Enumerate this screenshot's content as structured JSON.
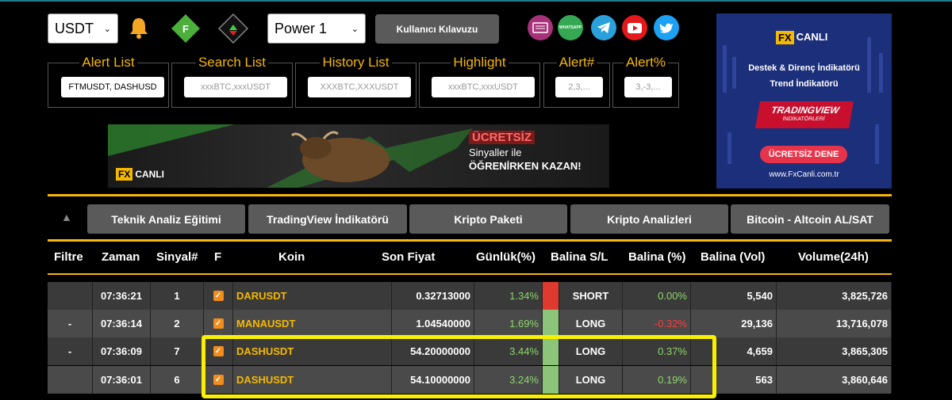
{
  "top": {
    "currency": "USDT",
    "power": "Power 1",
    "guide_label": "Kullanıcı Kılavuzu",
    "icons": [
      "bell-icon",
      "green-diamond-f-icon",
      "red-green-arrow-diamond-icon",
      "book-icon",
      "whatsapp-icon",
      "telegram-icon",
      "youtube-icon",
      "twitter-icon"
    ],
    "badge_letter": "F",
    "whatsapp_text": "WHATSAPP"
  },
  "filters": [
    {
      "label": "Alert List",
      "value": "FTMUSDT, DASHUSD",
      "placeholder": ""
    },
    {
      "label": "Search List",
      "value": "",
      "placeholder": "xxxBTC,xxxUSDT"
    },
    {
      "label": "History List",
      "value": "",
      "placeholder": "XXXBTC,XXXUSDT"
    },
    {
      "label": "Highlight",
      "value": "",
      "placeholder": "xxxBTC,xxxUSDT"
    },
    {
      "label": "Alert#",
      "value": "",
      "placeholder": "2,3,..."
    },
    {
      "label": "Alert%",
      "value": "",
      "placeholder": "3,-3,..."
    }
  ],
  "banner": {
    "logo_fx": "FX",
    "logo_text": "CANLI",
    "line1": "ÜCRETSİZ",
    "line2": "Sinyaller ile",
    "line3": "ÖĞRENİRKEN KAZAN!"
  },
  "ad": {
    "logo_fx": "FX",
    "logo_text": "CANLI",
    "line1": "Destek & Direnç İndikatörü",
    "line2": "Trend İndikatörü",
    "tv1": "TRADINGVIEW",
    "tv2": "İNDİKATÖRLERİ",
    "cta": "ÜCRETSİZ DENE",
    "url": "www.FxCanli.com.tr"
  },
  "nav": {
    "collapse_icon": "▲",
    "buttons": [
      "Teknik Analiz Eğitimi",
      "TradingView İndikatörü",
      "Kripto Paketi",
      "Kripto Analizleri",
      "Bitcoin - Altcoin AL/SAT"
    ]
  },
  "table": {
    "headers": [
      "Filtre",
      "Zaman",
      "Sinyal#",
      "F",
      "Koin",
      "Son Fiyat",
      "Günlük(%)",
      "Balina S/L",
      "Balina (%)",
      "Balina (Vol)",
      "Volume(24h)"
    ],
    "rows": [
      {
        "filtre": "",
        "zaman": "07:36:21",
        "sinyal": "1",
        "koin": "DARUSDT",
        "fiyat": "0.32713000",
        "gunluk": "1.34%",
        "side_color": "#e03a2e",
        "sl": "SHORT",
        "balina_pct": "0.00%",
        "pct_color": "green",
        "vol": "5,540",
        "volume": "3,825,726"
      },
      {
        "filtre": "-",
        "zaman": "07:36:14",
        "sinyal": "2",
        "koin": "MANAUSDT",
        "fiyat": "1.04540000",
        "gunluk": "1.69%",
        "side_color": "#8cc57a",
        "sl": "LONG",
        "balina_pct": "-0.32%",
        "pct_color": "red",
        "vol": "29,136",
        "volume": "13,716,078"
      },
      {
        "filtre": "-",
        "zaman": "07:36:09",
        "sinyal": "7",
        "koin": "DASHUSDT",
        "fiyat": "54.20000000",
        "gunluk": "3.44%",
        "side_color": "#8cc57a",
        "sl": "LONG",
        "balina_pct": "0.37%",
        "pct_color": "green",
        "vol": "4,659",
        "volume": "3,865,305"
      },
      {
        "filtre": "",
        "zaman": "07:36:01",
        "sinyal": "6",
        "koin": "DASHUSDT",
        "fiyat": "54.10000000",
        "gunluk": "3.24%",
        "side_color": "#8cc57a",
        "sl": "LONG",
        "balina_pct": "0.19%",
        "pct_color": "green",
        "vol": "563",
        "volume": "3,860,646"
      }
    ],
    "row_colors": [
      "#3a3a3a",
      "#4a4a4a",
      "#3a3a3a",
      "#4a4a4a"
    ],
    "highlight_color": "#f8f000"
  }
}
